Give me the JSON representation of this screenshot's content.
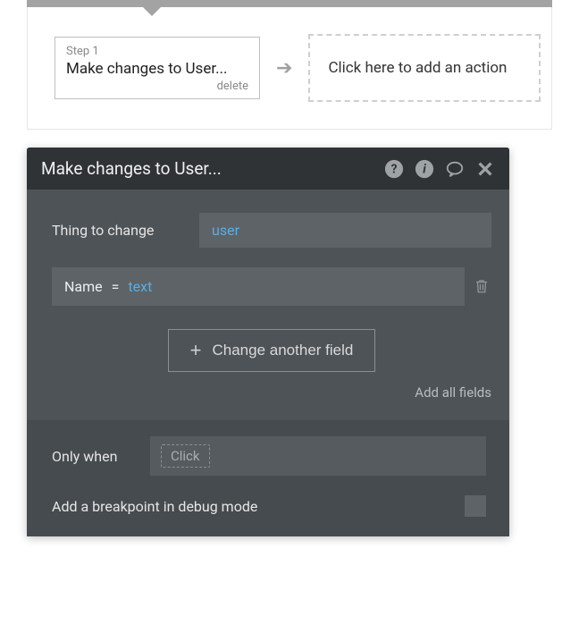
{
  "workflow": {
    "step_label": "Step 1",
    "step_title": "Make changes to User...",
    "delete_label": "delete",
    "add_action_label": "Click here to add an action"
  },
  "panel": {
    "title": "Make changes to User...",
    "thing_label": "Thing to change",
    "thing_value": "user",
    "field_name": "Name",
    "field_eq": "=",
    "field_value": "text",
    "change_another_label": "Change another field",
    "add_all_label": "Add all fields",
    "only_when_label": "Only when",
    "only_when_chip": "Click",
    "breakpoint_label": "Add a breakpoint in debug mode"
  }
}
